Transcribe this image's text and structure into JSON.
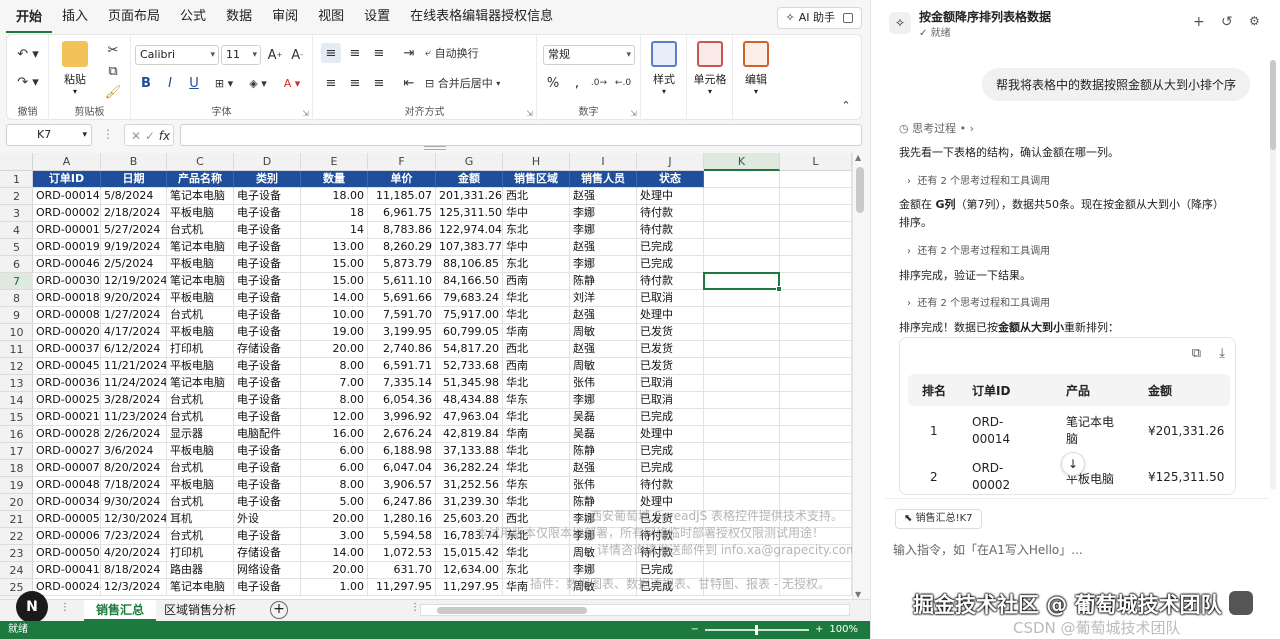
{
  "menu": {
    "tabs": [
      "开始",
      "插入",
      "页面布局",
      "公式",
      "数据",
      "审阅",
      "视图",
      "设置",
      "在线表格编辑器授权信息"
    ],
    "ai_helper": "AI 助手"
  },
  "ribbon": {
    "groups": {
      "undo": "撤销",
      "clipboard": "剪贴板",
      "font": "字体",
      "alignment": "对齐方式",
      "number": "数字"
    },
    "paste": "粘贴",
    "font_name": "Calibri",
    "font_size": "11",
    "wrap_text": "自动换行",
    "merge_center": "合并后居中",
    "number_format": "常规",
    "styles": "样式",
    "cells": "单元格",
    "editing": "编辑"
  },
  "formula_bar": {
    "name_box": "K7",
    "fx": "fx",
    "value": ""
  },
  "grid": {
    "columns": [
      "A",
      "B",
      "C",
      "D",
      "E",
      "F",
      "G",
      "H",
      "I",
      "J",
      "K",
      "L"
    ],
    "active_cell": "K7",
    "header": [
      "订单ID",
      "日期",
      "产品名称",
      "类别",
      "数量",
      "单价",
      "金额",
      "销售区域",
      "销售人员",
      "状态"
    ],
    "rows": [
      [
        "ORD-00014",
        "5/8/2024",
        "笔记本电脑",
        "电子设备",
        "18.00",
        "11,185.07",
        "201,331.26",
        "西北",
        "赵强",
        "处理中"
      ],
      [
        "ORD-00002",
        "2/18/2024",
        "平板电脑",
        "电子设备",
        "18",
        "6,961.75",
        "125,311.50",
        "华中",
        "李娜",
        "待付款"
      ],
      [
        "ORD-00001",
        "5/27/2024",
        "台式机",
        "电子设备",
        "14",
        "8,783.86",
        "122,974.04",
        "东北",
        "李娜",
        "待付款"
      ],
      [
        "ORD-00019",
        "9/19/2024",
        "笔记本电脑",
        "电子设备",
        "13.00",
        "8,260.29",
        "107,383.77",
        "华中",
        "赵强",
        "已完成"
      ],
      [
        "ORD-00046",
        "2/5/2024",
        "平板电脑",
        "电子设备",
        "15.00",
        "5,873.79",
        "88,106.85",
        "东北",
        "李娜",
        "已完成"
      ],
      [
        "ORD-00030",
        "12/19/2024",
        "笔记本电脑",
        "电子设备",
        "15.00",
        "5,611.10",
        "84,166.50",
        "西南",
        "陈静",
        "待付款"
      ],
      [
        "ORD-00018",
        "9/20/2024",
        "平板电脑",
        "电子设备",
        "14.00",
        "5,691.66",
        "79,683.24",
        "华北",
        "刘洋",
        "已取消"
      ],
      [
        "ORD-00008",
        "1/27/2024",
        "台式机",
        "电子设备",
        "10.00",
        "7,591.70",
        "75,917.00",
        "华北",
        "赵强",
        "处理中"
      ],
      [
        "ORD-00020",
        "4/17/2024",
        "平板电脑",
        "电子设备",
        "19.00",
        "3,199.95",
        "60,799.05",
        "华南",
        "周敏",
        "已发货"
      ],
      [
        "ORD-00037",
        "6/12/2024",
        "打印机",
        "存储设备",
        "20.00",
        "2,740.86",
        "54,817.20",
        "西北",
        "赵强",
        "已发货"
      ],
      [
        "ORD-00045",
        "11/21/2024",
        "平板电脑",
        "电子设备",
        "8.00",
        "6,591.71",
        "52,733.68",
        "西南",
        "周敏",
        "已发货"
      ],
      [
        "ORD-00036",
        "11/24/2024",
        "笔记本电脑",
        "电子设备",
        "7.00",
        "7,335.14",
        "51,345.98",
        "华北",
        "张伟",
        "已取消"
      ],
      [
        "ORD-00025",
        "3/28/2024",
        "台式机",
        "电子设备",
        "8.00",
        "6,054.36",
        "48,434.88",
        "华东",
        "李娜",
        "已取消"
      ],
      [
        "ORD-00021",
        "11/23/2024",
        "台式机",
        "电子设备",
        "12.00",
        "3,996.92",
        "47,963.04",
        "华北",
        "吴磊",
        "已完成"
      ],
      [
        "ORD-00028",
        "2/26/2024",
        "显示器",
        "电脑配件",
        "16.00",
        "2,676.24",
        "42,819.84",
        "华南",
        "吴磊",
        "处理中"
      ],
      [
        "ORD-00027",
        "3/6/2024",
        "平板电脑",
        "电子设备",
        "6.00",
        "6,188.98",
        "37,133.88",
        "华北",
        "陈静",
        "已完成"
      ],
      [
        "ORD-00007",
        "8/20/2024",
        "台式机",
        "电子设备",
        "6.00",
        "6,047.04",
        "36,282.24",
        "华北",
        "赵强",
        "已完成"
      ],
      [
        "ORD-00048",
        "7/18/2024",
        "平板电脑",
        "电子设备",
        "8.00",
        "3,906.57",
        "31,252.56",
        "华东",
        "张伟",
        "待付款"
      ],
      [
        "ORD-00034",
        "9/30/2024",
        "台式机",
        "电子设备",
        "5.00",
        "6,247.86",
        "31,239.30",
        "华北",
        "陈静",
        "处理中"
      ],
      [
        "ORD-00005",
        "12/30/2024",
        "耳机",
        "外设",
        "20.00",
        "1,280.16",
        "25,603.20",
        "西北",
        "李娜",
        "已发货"
      ],
      [
        "ORD-00006",
        "7/23/2024",
        "台式机",
        "电子设备",
        "3.00",
        "5,594.58",
        "16,783.74",
        "东北",
        "李娜",
        "待付款"
      ],
      [
        "ORD-00050",
        "4/20/2024",
        "打印机",
        "存储设备",
        "14.00",
        "1,072.53",
        "15,015.42",
        "华北",
        "周敏",
        "待付款"
      ],
      [
        "ORD-00041",
        "8/18/2024",
        "路由器",
        "网络设备",
        "20.00",
        "631.70",
        "12,634.00",
        "东北",
        "李娜",
        "已完成"
      ],
      [
        "ORD-00024",
        "12/3/2024",
        "笔记本电脑",
        "电子设备",
        "1.00",
        "11,297.95",
        "11,297.95",
        "华南",
        "周敏",
        "已完成"
      ]
    ]
  },
  "watermark": {
    "line1": "西安葡萄城 SpreadJS 表格控件提供技术支持。",
    "line2": "本试用版本仅限本地部署，所有网络临时部署授权仅限测试用途！",
    "line3": "详情咨询请发送邮件到 info.xa@grapecity.com",
    "line4": "插件：数据图表、数据透视表、甘特图、报表 - 无授权。"
  },
  "sheets": {
    "tabs": [
      "销售汇总",
      "区域销售分析"
    ],
    "active": "销售汇总",
    "badge": "N"
  },
  "status": {
    "text": "就绪",
    "zoom": "100%"
  },
  "panel": {
    "title": "按金额降序排列表格数据",
    "status": "就绪",
    "user_message": "帮我将表格中的数据按照金额从大到小排个序",
    "thinking": "思考过程",
    "msg1": "我先看一下表格的结构，确认金额在哪一列。",
    "tool_calls": "还有 2 个思考过程和工具调用",
    "msg2_a": "金额在 ",
    "msg2_col": "G列",
    "msg2_b": "（第7列），数据共50条。现在按金额从大到小（降序）",
    "msg2_c": "排序。",
    "msg3": "排序完成，验证一下结果。",
    "msg4_a": "排序完成！数据已按",
    "msg4_b": "金额从大到小",
    "msg4_c": "重新排列：",
    "table": {
      "headers": [
        "排名",
        "订单ID",
        "产品",
        "金额"
      ],
      "rows": [
        [
          "1",
          "ORD-\n00014",
          "笔记本电\n脑",
          "¥201,331.26"
        ],
        [
          "2",
          "ORD-\n00002",
          "平板电脑",
          "¥125,311.50"
        ]
      ]
    },
    "context_chip": "销售汇总!K7",
    "input_placeholder": "输入指令，如「在A1写入Hello」...",
    "footer_watermark": "掘金技术社区 @ 葡萄城技术团队",
    "footer_sub": "CSDN @葡萄城技术团队"
  }
}
